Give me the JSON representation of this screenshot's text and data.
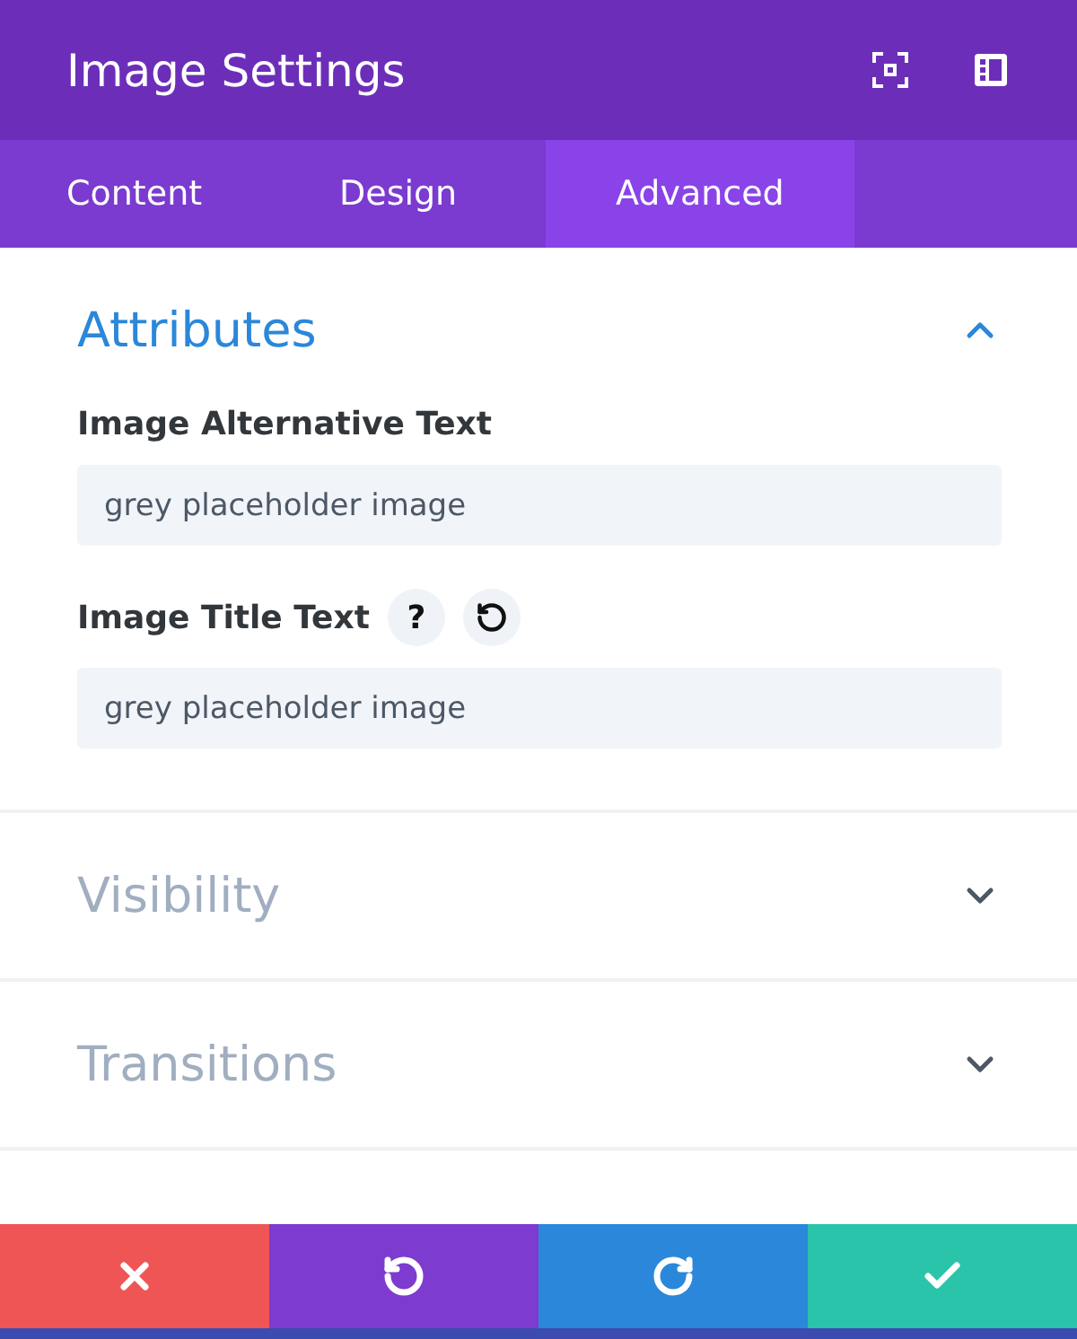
{
  "window": {
    "title": "Image Settings"
  },
  "tabs": [
    {
      "label": "Content",
      "selected": false
    },
    {
      "label": "Design",
      "selected": false
    },
    {
      "label": "Advanced",
      "selected": true
    }
  ],
  "sections": [
    {
      "title": "Attributes",
      "expanded": true,
      "fields": [
        {
          "label": "Image Alternative Text",
          "value": "grey placeholder image",
          "help": false
        },
        {
          "label": "Image Title Text",
          "value": "grey placeholder image",
          "help": true,
          "help_mark": "?"
        }
      ]
    },
    {
      "title": "Visibility",
      "expanded": false
    },
    {
      "title": "Transitions",
      "expanded": false
    }
  ],
  "footer": [
    {
      "kind": "discard"
    },
    {
      "kind": "undo"
    },
    {
      "kind": "redo"
    },
    {
      "kind": "save"
    }
  ]
}
